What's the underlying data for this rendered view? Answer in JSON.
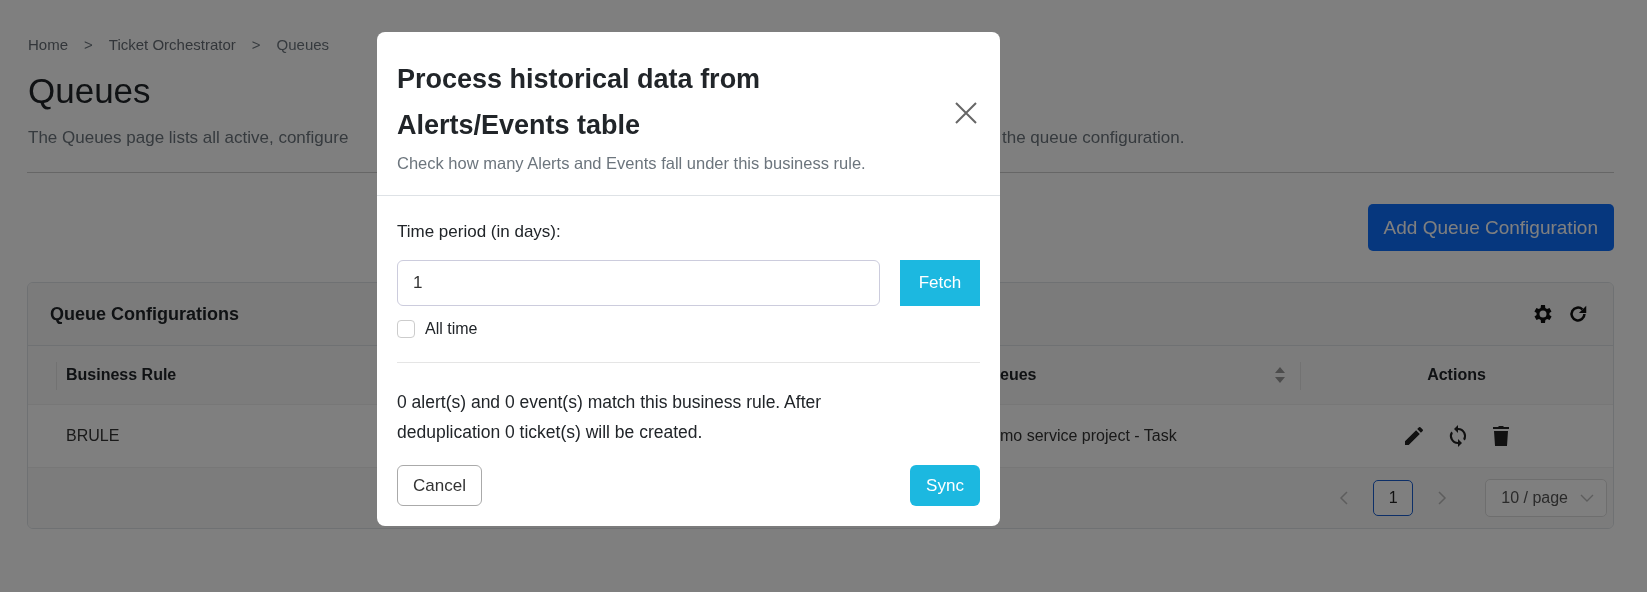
{
  "breadcrumb": [
    {
      "kind": "link",
      "label": "Home"
    },
    {
      "kind": "separator",
      "label": ">"
    },
    {
      "kind": "link",
      "label": "Ticket Orchestrator"
    },
    {
      "kind": "separator",
      "label": ">"
    },
    {
      "kind": "current",
      "label": "Queues"
    }
  ],
  "page_title": "Queues",
  "description": {
    "before_dialog": "The Queues page lists all active, configure",
    "after_dialog": "the queue configuration."
  },
  "add_button": "Add Queue Configuration",
  "card": {
    "title": "Queue Configurations",
    "columns": [
      {
        "label": "Business Rule"
      },
      {
        "label": "eues"
      },
      {
        "label": "Actions"
      }
    ],
    "rows": [
      {
        "business_rule": "BRULE",
        "queues": "mo service project - Task"
      }
    ],
    "pagination": {
      "pages": [
        {
          "label": "1",
          "selected": true
        }
      ],
      "page_size": "10 / page"
    }
  },
  "dialog": {
    "title": "Process historical data from Alerts/Events table",
    "subtitle": "Check how many Alerts and Events fall under this business rule.",
    "field_label": "Time period (in days):",
    "field_value": "1",
    "fetch_button": "Fetch",
    "all_time": {
      "label": "All time",
      "checked": false
    },
    "result": "0 alert(s) and 0 event(s) match this business rule. After deduplication 0 ticket(s) will be created.",
    "cancel_button": "Cancel",
    "sync_button": "Sync"
  }
}
